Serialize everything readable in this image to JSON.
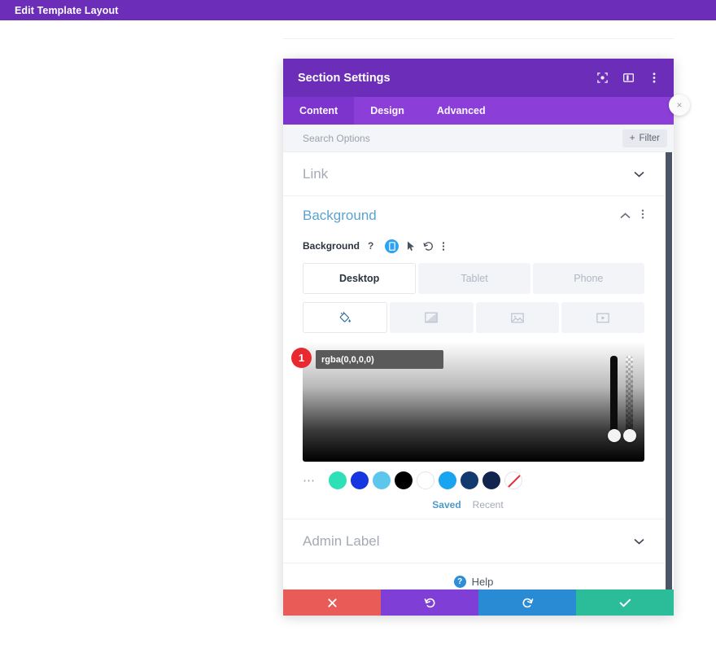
{
  "topbar": {
    "title": "Edit Template Layout",
    "bg": "#6c2eb9"
  },
  "modal": {
    "title": "Section Settings",
    "header_icons": [
      {
        "name": "focus-icon",
        "glyph": "focus"
      },
      {
        "name": "layout-panel-icon",
        "glyph": "panel"
      },
      {
        "name": "more-vertical-icon",
        "glyph": "dots"
      }
    ],
    "tabs": [
      {
        "label": "Content",
        "active": true
      },
      {
        "label": "Design",
        "active": false
      },
      {
        "label": "Advanced",
        "active": false
      }
    ],
    "close_label": "×"
  },
  "search": {
    "placeholder": "Search Options",
    "value": "",
    "filter_label": "Filter",
    "filter_plus": "+"
  },
  "sections": {
    "link": {
      "label": "Link",
      "chevron": "⌄"
    },
    "admin_label": {
      "label": "Admin Label",
      "chevron": "⌄"
    },
    "background": {
      "title": "Background",
      "collapse_chevron": "⌃",
      "menu_dots": "⋮",
      "field_label": "Background",
      "help_mark": "?",
      "responsive_icon": "device-icon",
      "hover_icon": "cursor-icon",
      "reset_icon": "reset-icon",
      "options_icon": "more-vertical-icon",
      "devices": [
        {
          "label": "Desktop",
          "active": true
        },
        {
          "label": "Tablet",
          "active": false
        },
        {
          "label": "Phone",
          "active": false
        }
      ],
      "types": [
        {
          "name": "background-color",
          "icon": "paint-bucket-icon",
          "active": true
        },
        {
          "name": "background-gradient",
          "icon": "gradient-icon",
          "active": false
        },
        {
          "name": "background-image",
          "icon": "image-icon",
          "active": false
        },
        {
          "name": "background-video",
          "icon": "video-icon",
          "active": false
        }
      ],
      "picker": {
        "badge_number": "1",
        "color_value": "rgba(0,0,0,0)",
        "confirm_glyph": "✔",
        "hue_slider": "hue-slider",
        "alpha_slider": "alpha-slider"
      },
      "swatches": [
        {
          "name": "swatch-turquoise",
          "color": "#2de0b6"
        },
        {
          "name": "swatch-blue",
          "color": "#1536e0"
        },
        {
          "name": "swatch-sky",
          "color": "#5cc6ec"
        },
        {
          "name": "swatch-black",
          "color": "#000000"
        },
        {
          "name": "swatch-white",
          "color": "#ffffff"
        },
        {
          "name": "swatch-cyan-blue",
          "color": "#18a4ee"
        },
        {
          "name": "swatch-navy",
          "color": "#123a6e"
        },
        {
          "name": "swatch-dark-navy",
          "color": "#10244e"
        },
        {
          "name": "swatch-transparent",
          "color": "none"
        }
      ],
      "more_dots": "⋯",
      "palette_tabs": [
        {
          "label": "Saved",
          "active": true
        },
        {
          "label": "Recent",
          "active": false
        }
      ]
    }
  },
  "help": {
    "icon_mark": "?",
    "label": "Help"
  },
  "footer": [
    {
      "name": "cancel-button",
      "glyph": "✖",
      "color": "#e85b57"
    },
    {
      "name": "undo-button",
      "glyph": "↺",
      "color": "#7f3fd6"
    },
    {
      "name": "redo-button",
      "glyph": "↻",
      "color": "#2a8bd5"
    },
    {
      "name": "save-button",
      "glyph": "✔",
      "color": "#2bbd9a"
    }
  ]
}
